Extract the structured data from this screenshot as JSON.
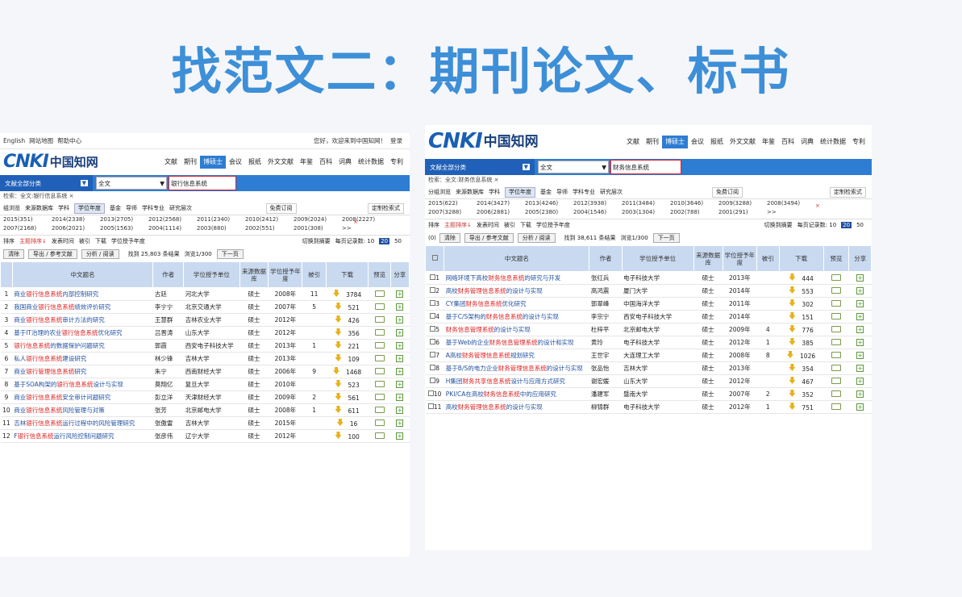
{
  "slide_title": "找范文二：期刊论文、标书",
  "left": {
    "topbar": [
      "English",
      "网站地图",
      "帮助中心"
    ],
    "topbar_right": [
      "您好，欢迎来到中国知网！",
      "登录"
    ],
    "logo_latin": "CNKI",
    "logo_cn": "中国知网",
    "nav": [
      "文献",
      "期刊",
      "博硕士",
      "会议",
      "报纸",
      "外文文献",
      "年鉴",
      "百科",
      "词典",
      "统计数据",
      "专利"
    ],
    "category": "文献全部分类",
    "field": "全文",
    "keyword": "银行信息系统",
    "crumb": "检索：全文:银行信息系统 ×",
    "groups": [
      "组浏览",
      "来源数据库",
      "学科",
      "学位年度",
      "基金",
      "导师",
      "学科专业",
      "研究层次"
    ],
    "group_right": [
      "免费订阅",
      "定制检索式"
    ],
    "years_row1": [
      "2015(351)",
      "2014(2338)",
      "2013(2705)",
      "2012(2568)",
      "2011(2340)",
      "2010(2412)",
      "2009(2024)",
      "2008(2227)"
    ],
    "years_row2": [
      "2007(2168)",
      "2006(2021)",
      "2005(1563)",
      "2004(1114)",
      "2003(880)",
      "2002(551)",
      "2001(308)",
      ">>"
    ],
    "sort_items": [
      "排序",
      "主题排序↓",
      "发表时间",
      "被引",
      "下载",
      "学位授予年度"
    ],
    "sort_right": [
      "切换到摘要",
      "每页记录数: 10",
      "20",
      "50"
    ],
    "buttons": [
      "清除",
      "导出 / 参考文献",
      "分析 / 阅读"
    ],
    "result_info": [
      "找到 25,803 条结果",
      "浏览1/300",
      "下一页"
    ],
    "headers": [
      "",
      "中文题名",
      "作者",
      "学位授予单位",
      "来源数据库",
      "学位授予年度",
      "被引",
      "下载",
      "预览",
      "分享"
    ],
    "rows": [
      {
        "n": "1",
        "pre": "商业",
        "hl": "银行信息系统",
        "post": "内部控制研究",
        "author": "古廷",
        "unit": "河北大学",
        "db": "硕士",
        "year": "2008年",
        "cite": "11",
        "dl": "3784"
      },
      {
        "n": "2",
        "pre": "我国商业",
        "hl": "银行信息系统",
        "post": "绩效评价研究",
        "author": "李宁宁",
        "unit": "北京交通大学",
        "db": "硕士",
        "year": "2007年",
        "cite": "5",
        "dl": "521"
      },
      {
        "n": "3",
        "pre": "商业",
        "hl": "银行信息系统",
        "post": "审计方法的研究",
        "author": "王慧群",
        "unit": "吉林农业大学",
        "db": "硕士",
        "year": "2012年",
        "cite": "",
        "dl": "426"
      },
      {
        "n": "4",
        "pre": "基于IT治理的农业",
        "hl": "银行信息系统",
        "post": "优化研究",
        "author": "吕晋涛",
        "unit": "山东大学",
        "db": "硕士",
        "year": "2012年",
        "cite": "",
        "dl": "356"
      },
      {
        "n": "5",
        "pre": "",
        "hl": "银行信息系统",
        "post": "的数据保护问题研究",
        "author": "郭霞",
        "unit": "西安电子科技大学",
        "db": "硕士",
        "year": "2013年",
        "cite": "1",
        "dl": "221"
      },
      {
        "n": "6",
        "pre": "私人",
        "hl": "银行信息系统",
        "post": "建设研究",
        "author": "林少锋",
        "unit": "吉林大学",
        "db": "硕士",
        "year": "2013年",
        "cite": "",
        "dl": "109"
      },
      {
        "n": "7",
        "pre": "商业",
        "hl": "银行管理信息系统",
        "post": "研究",
        "author": "朱宁",
        "unit": "西南财经大学",
        "db": "硕士",
        "year": "2006年",
        "cite": "9",
        "dl": "1468"
      },
      {
        "n": "8",
        "pre": "基于SOA构架的",
        "hl": "银行信息系统",
        "post": "设计与实现",
        "author": "莫翔亿",
        "unit": "复旦大学",
        "db": "硕士",
        "year": "2010年",
        "cite": "",
        "dl": "523"
      },
      {
        "n": "9",
        "pre": "商业",
        "hl": "银行信息系统",
        "post": "安全审计问题研究",
        "author": "彭立洋",
        "unit": "天津财经大学",
        "db": "硕士",
        "year": "2009年",
        "cite": "2",
        "dl": "561"
      },
      {
        "n": "10",
        "pre": "商业",
        "hl": "银行信息系统",
        "post": "风险管理与对策",
        "author": "张芳",
        "unit": "北京邮电大学",
        "db": "硕士",
        "year": "2008年",
        "cite": "1",
        "dl": "611"
      },
      {
        "n": "11",
        "pre": "吉林",
        "hl": "银行信息系统",
        "post": "运行过程中的风险管理研究",
        "author": "张傲雷",
        "unit": "吉林大学",
        "db": "硕士",
        "year": "2015年",
        "cite": "",
        "dl": "16"
      },
      {
        "n": "12",
        "pre": "F",
        "hl": "银行信息系统",
        "post": "运行风险控制问题研究",
        "author": "张彦伟",
        "unit": "辽宁大学",
        "db": "硕士",
        "year": "2012年",
        "cite": "",
        "dl": "100"
      }
    ]
  },
  "right": {
    "logo_latin": "CNKI",
    "logo_cn": "中国知网",
    "nav": [
      "文献",
      "期刊",
      "博硕士",
      "会议",
      "报纸",
      "外文文献",
      "年鉴",
      "百科",
      "词典",
      "统计数据",
      "专利"
    ],
    "category": "文献全部分类",
    "field": "全文",
    "keyword": "财务信息系统",
    "crumb": "检索：全文:财务信息系统 ×",
    "groups": [
      "分组浏览",
      "来源数据库",
      "学科",
      "学位年度",
      "基金",
      "导师",
      "学科专业",
      "研究层次"
    ],
    "group_right": [
      "免费订阅",
      "定制检索式"
    ],
    "years_row1": [
      "2015(622)",
      "2014(3427)",
      "2013(4246)",
      "2012(3938)",
      "2011(3484)",
      "2010(3646)",
      "2009(3288)",
      "2008(3494)"
    ],
    "years_row2": [
      "2007(3288)",
      "2006(2881)",
      "2005(2380)",
      "2004(1546)",
      "2003(1304)",
      "2002(788)",
      "2001(291)",
      ">>"
    ],
    "sort_items": [
      "排序",
      "主题排序↓",
      "发表时间",
      "被引",
      "下载",
      "学位授予年度"
    ],
    "sort_right": [
      "切换到摘要",
      "每页记录数: 10",
      "20",
      "50"
    ],
    "buttons": [
      "清除",
      "导出 / 参考文献",
      "分析 / 阅读"
    ],
    "selected": "(0)",
    "result_info": [
      "找到 38,611 条结果",
      "浏览1/300",
      "下一页"
    ],
    "headers": [
      "",
      "中文题名",
      "作者",
      "学位授予单位",
      "来源数据库",
      "学位授予年度",
      "被引",
      "下载",
      "预览",
      "分享"
    ],
    "rows": [
      {
        "n": "1",
        "pre": "网络环境下高校",
        "hl": "财务信息系统",
        "post": "的研究与开发",
        "author": "张红兵",
        "unit": "电子科技大学",
        "db": "硕士",
        "year": "2013年",
        "cite": "",
        "dl": "444"
      },
      {
        "n": "2",
        "pre": "高校",
        "hl": "财务管理信息系统",
        "post": "的设计与实现",
        "author": "高鸿震",
        "unit": "厦门大学",
        "db": "硕士",
        "year": "2014年",
        "cite": "",
        "dl": "553"
      },
      {
        "n": "3",
        "pre": "CY集团",
        "hl": "财务信息系统",
        "post": "优化研究",
        "author": "郭翠峰",
        "unit": "中国海洋大学",
        "db": "硕士",
        "year": "2011年",
        "cite": "",
        "dl": "302"
      },
      {
        "n": "4",
        "pre": "基于C/S架构的",
        "hl": "财务信息系统",
        "post": "的设计与实现",
        "author": "李宗宁",
        "unit": "西安电子科技大学",
        "db": "硕士",
        "year": "2014年",
        "cite": "",
        "dl": "151"
      },
      {
        "n": "5",
        "pre": "",
        "hl": "财务信息管理系统",
        "post": "的设计与实现",
        "author": "杜梓平",
        "unit": "北京邮电大学",
        "db": "硕士",
        "year": "2009年",
        "cite": "4",
        "dl": "776"
      },
      {
        "n": "6",
        "pre": "基于Web的企业",
        "hl": "财务信息管理系统",
        "post": "的设计和实现",
        "author": "黄玲",
        "unit": "电子科技大学",
        "db": "硕士",
        "year": "2012年",
        "cite": "1",
        "dl": "385"
      },
      {
        "n": "7",
        "pre": "A高校",
        "hl": "财务管理信息系统",
        "post": "规划研究",
        "author": "王世宇",
        "unit": "大连理工大学",
        "db": "硕士",
        "year": "2008年",
        "cite": "8",
        "dl": "1026"
      },
      {
        "n": "8",
        "pre": "基于B/S的电力企业",
        "hl": "财务管理信息系统",
        "post": "的设计与实现",
        "author": "张品怡",
        "unit": "吉林大学",
        "db": "硕士",
        "year": "2013年",
        "cite": "",
        "dl": "354"
      },
      {
        "n": "9",
        "pre": "H集团",
        "hl": "财务共享信息系统",
        "post": "设计与应用方式研究",
        "author": "谢宏媛",
        "unit": "山东大学",
        "db": "硕士",
        "year": "2012年",
        "cite": "",
        "dl": "467"
      },
      {
        "n": "10",
        "pre": "PKI/CA在高校",
        "hl": "财务信息系统",
        "post": "中的应用研究",
        "author": "潘建军",
        "unit": "暨南大学",
        "db": "硕士",
        "year": "2007年",
        "cite": "2",
        "dl": "352"
      },
      {
        "n": "11",
        "pre": "高校",
        "hl": "财务管理信息系统",
        "post": "的设计与实现",
        "author": "柳锦群",
        "unit": "电子科技大学",
        "db": "硕士",
        "year": "2012年",
        "cite": "1",
        "dl": "751"
      }
    ]
  }
}
